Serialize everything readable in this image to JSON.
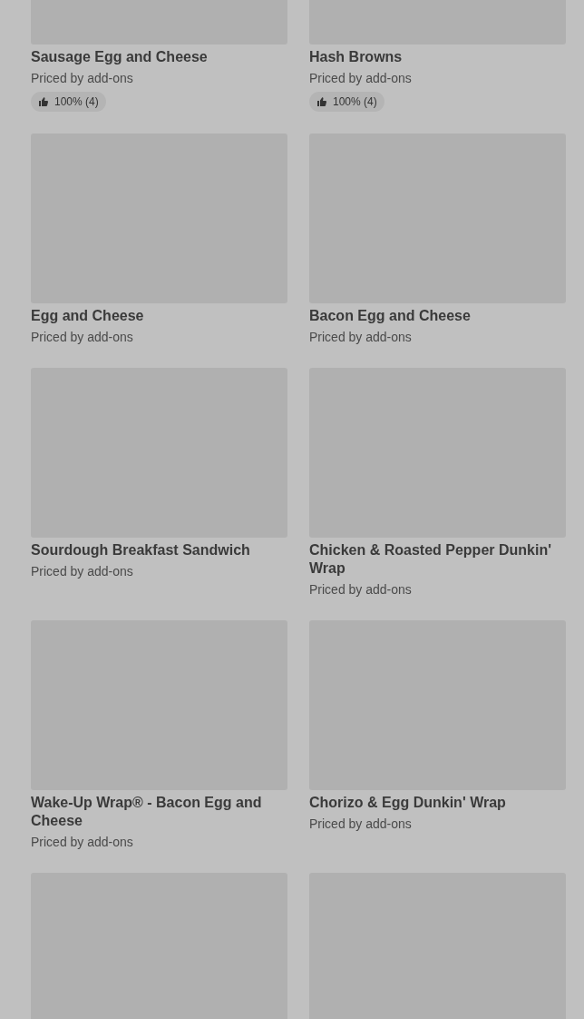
{
  "items": [
    {
      "kind": "rated",
      "name": "Sausage Egg and Cheese",
      "price": "Priced by add-ons",
      "rating": "100% (4)"
    },
    {
      "kind": "rated",
      "name": "Hash Browns",
      "price": "Priced by add-ons",
      "rating": "100% (4)"
    },
    {
      "name": "Egg and Cheese",
      "price": "Priced by add-ons"
    },
    {
      "name": "Bacon Egg and Cheese",
      "price": "Priced by add-ons"
    },
    {
      "name": "Sourdough Breakfast Sandwich",
      "price": "Priced by add-ons"
    },
    {
      "name": "Chicken & Roasted Pepper Dunkin' Wrap",
      "price": "Priced by add-ons"
    },
    {
      "name": "Wake-Up Wrap® - Bacon Egg and Cheese",
      "price": "Priced by add-ons"
    },
    {
      "name": "Chorizo & Egg Dunkin' Wrap",
      "price": "Priced by add-ons"
    },
    {
      "kind": "image_only"
    },
    {
      "kind": "image_only"
    }
  ]
}
